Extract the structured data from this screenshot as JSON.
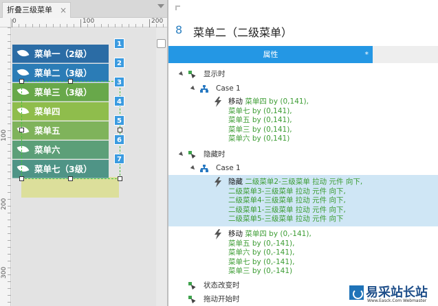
{
  "tab": {
    "title": "折叠三级菜单",
    "close": "×"
  },
  "ruler": {
    "h_labels": [
      "0",
      "100",
      "200"
    ],
    "v_labels": [
      "100",
      "200",
      "300"
    ]
  },
  "menu_items": [
    {
      "label": "菜单一（2级）",
      "badge": "1",
      "color": "#2b6ca5"
    },
    {
      "label": "菜单二（3级）",
      "badge": "2",
      "color": "#2b7cb6"
    },
    {
      "label": "菜单三（3级）",
      "badge": "3",
      "color": "#68a84a"
    },
    {
      "label": "菜单四",
      "badge": "4",
      "color": "#8fbd4c"
    },
    {
      "label": "菜单五",
      "badge": "5",
      "color": "#7fb35b"
    },
    {
      "label": "菜单六",
      "badge": "6",
      "color": "#5c9f78"
    },
    {
      "label": "菜单七（3级）",
      "badge": "7",
      "color": "#4f9486"
    }
  ],
  "panel": {
    "number": "8",
    "title": "菜单二（二级菜单）",
    "tab_label": "属性",
    "tab_star": "*"
  },
  "tree": {
    "event_show": "显示时",
    "case_1a": "Case 1",
    "event_hide": "隐藏时",
    "case_1b": "Case 1",
    "event_state": "状态改变时",
    "event_drag": "拖动开始时"
  },
  "actions": {
    "show_move": [
      [
        "移动",
        "菜单四 by (0,141),"
      ],
      [
        "",
        "菜单七 by (0,141),"
      ],
      [
        "",
        "菜单五 by (0,141),"
      ],
      [
        "",
        "菜单三 by (0,141),"
      ],
      [
        "",
        "菜单六 by (0,141)"
      ]
    ],
    "hide_hide": [
      [
        "隐藏",
        "二级菜单2-三级菜单 拉动 元件 向下,"
      ],
      [
        "",
        "二级菜单3-三级菜单 拉动 元件 向下,"
      ],
      [
        "",
        "二级菜单4-三级菜单 拉动 元件 向下,"
      ],
      [
        "",
        "二级菜单1-三级菜单 拉动 元件 向下,"
      ],
      [
        "",
        "二级菜单5-三级菜单 拉动 元件 向下"
      ]
    ],
    "hide_move": [
      [
        "移动",
        "菜单四 by (0,-141),"
      ],
      [
        "",
        "菜单五 by (0,-141),"
      ],
      [
        "",
        "菜单六 by (0,-141),"
      ],
      [
        "",
        "菜单七 by (0,-141),"
      ],
      [
        "",
        "菜单三 by (0,-141)"
      ]
    ]
  },
  "watermark": {
    "title": "易采站长站",
    "subtitle": "Www.Easck.Com Webmaster"
  },
  "colors": {
    "accent": "#2497e4",
    "highlight": "#cfe6f5",
    "action_green": "#3c9c33",
    "badge": "#3b9be0"
  }
}
